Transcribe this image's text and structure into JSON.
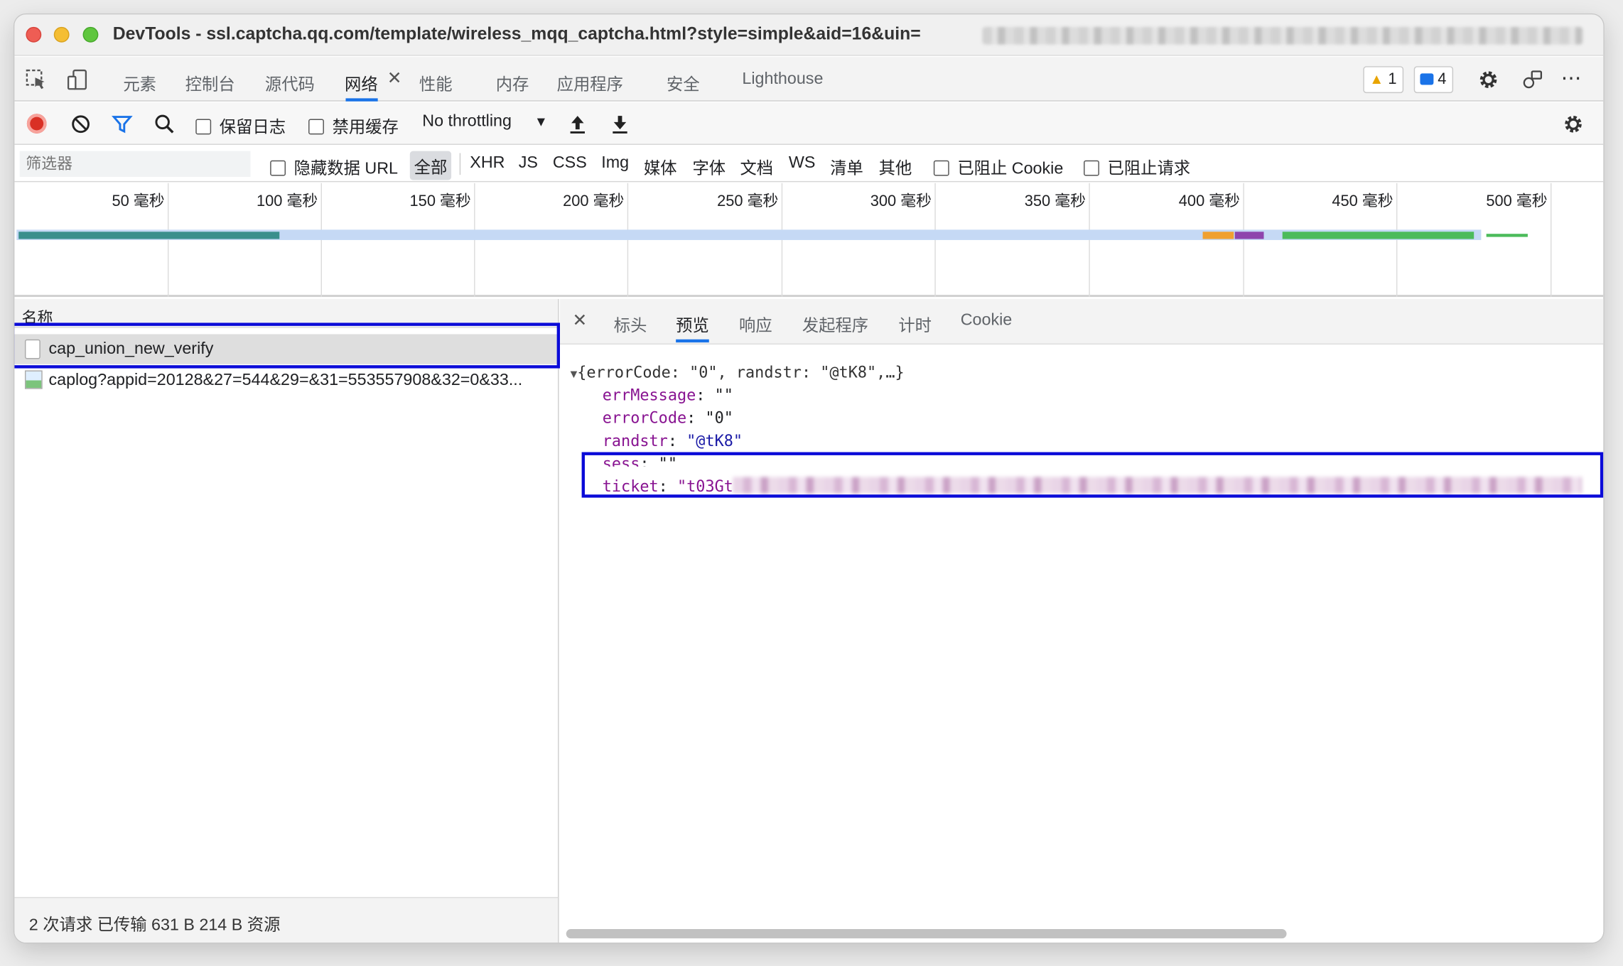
{
  "window": {
    "title": "DevTools - ssl.captcha.qq.com/template/wireless_mqq_captcha.html?style=simple&aid=16&uin="
  },
  "tabs": [
    {
      "label": "元素"
    },
    {
      "label": "控制台"
    },
    {
      "label": "源代码"
    },
    {
      "label": "网络"
    },
    {
      "label": "性能"
    },
    {
      "label": "内存"
    },
    {
      "label": "应用程序"
    },
    {
      "label": "安全"
    },
    {
      "label": "Lighthouse"
    }
  ],
  "badges": {
    "warnings": "1",
    "messages": "4"
  },
  "toolbar": {
    "preserve_log": "保留日志",
    "disable_cache": "禁用缓存",
    "throttling": "No throttling"
  },
  "filter": {
    "placeholder": "筛选器",
    "hide_data_url": "隐藏数据 URL",
    "types": [
      "全部",
      "XHR",
      "JS",
      "CSS",
      "Img",
      "媒体",
      "字体",
      "文档",
      "WS",
      "清单",
      "其他"
    ],
    "blocked_cookie": "已阻止 Cookie",
    "blocked_requests": "已阻止请求"
  },
  "timeline": {
    "ticks": [
      "50 毫秒",
      "100 毫秒",
      "150 毫秒",
      "200 毫秒",
      "250 毫秒",
      "300 毫秒",
      "350 毫秒",
      "400 毫秒",
      "450 毫秒",
      "500 毫秒"
    ]
  },
  "requests": {
    "column_name": "名称",
    "rows": [
      {
        "name": "cap_union_new_verify"
      },
      {
        "name": "caplog?appid=20128&27=544&29=&31=553557908&32=0&33..."
      }
    ],
    "status": "2 次请求  已传输 631 B  214 B 资源"
  },
  "detail": {
    "tabs": [
      "标头",
      "预览",
      "响应",
      "发起程序",
      "计时",
      "Cookie"
    ],
    "preview": {
      "summary": "{errorCode: \"0\", randstr: \"@tK8\",…}",
      "lines": [
        {
          "key": "errMessage",
          "value": "\"\""
        },
        {
          "key": "errorCode",
          "value": "\"0\""
        },
        {
          "key": "randstr",
          "value": "\"@tK8\""
        },
        {
          "key": "sess",
          "value": "\"\""
        },
        {
          "key": "ticket",
          "value": "\"t03Gt"
        }
      ]
    }
  }
}
